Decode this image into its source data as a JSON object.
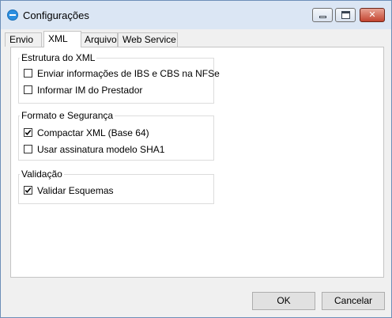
{
  "window": {
    "title": "Configurações",
    "icon": "app-logo-icon",
    "controls": {
      "minimize": "minimize-icon",
      "maximize": "maximize-icon",
      "close": "close-icon",
      "close_color": "#c34430"
    }
  },
  "tabs": [
    {
      "label": "Envio",
      "active": false
    },
    {
      "label": "XML",
      "active": true
    },
    {
      "label": "Arquivo",
      "active": false
    },
    {
      "label": "Web Service",
      "active": false
    }
  ],
  "groups": [
    {
      "legend": "Estrutura do XML",
      "options": [
        {
          "label": "Enviar informações de IBS e CBS na NFSe",
          "checked": false
        },
        {
          "label": "Informar IM do Prestador",
          "checked": false
        }
      ]
    },
    {
      "legend": "Formato e Segurança",
      "options": [
        {
          "label": "Compactar XML (Base 64)",
          "checked": true
        },
        {
          "label": "Usar assinatura modelo SHA1",
          "checked": false
        }
      ]
    },
    {
      "legend": "Validação",
      "options": [
        {
          "label": "Validar Esquemas",
          "checked": true
        }
      ]
    }
  ],
  "buttons": {
    "ok": "OK",
    "cancel": "Cancelar"
  }
}
